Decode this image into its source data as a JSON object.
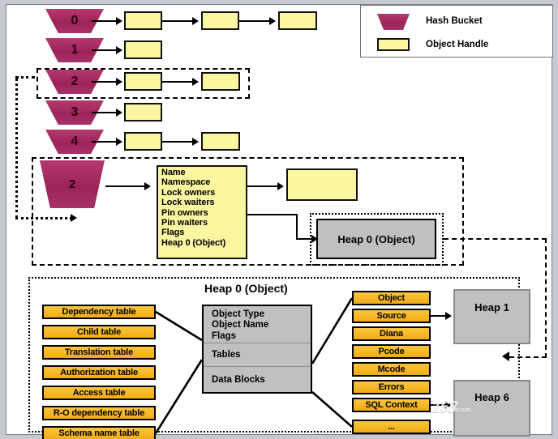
{
  "legend": {
    "items": [
      {
        "label": "Hash Bucket",
        "icon": "trapezoid-icon",
        "color": "#a32a60"
      },
      {
        "label": "Object Handle",
        "icon": "rectangle-icon",
        "color": "#fbf6a0"
      }
    ]
  },
  "hash_table": {
    "buckets": [
      {
        "id": "0",
        "handles": 3
      },
      {
        "id": "1",
        "handles": 1
      },
      {
        "id": "2",
        "handles": 2
      },
      {
        "id": "3",
        "handles": 1
      },
      {
        "id": "4",
        "handles": 2
      }
    ],
    "highlighted_bucket": "2"
  },
  "detail": {
    "bucket_label": "2",
    "handle_fields": [
      "Name",
      "Namespace",
      "Lock owners",
      "Lock waiters",
      "Pin owners",
      "Pin waiters",
      "Flags",
      "Heap 0 (Object)"
    ],
    "next_handle_label": "",
    "heap_box_label": "Heap 0 (Object)"
  },
  "heap_detail": {
    "title": "Heap 0 (Object)",
    "table_sections": [
      {
        "lines": [
          "Object Type",
          "Object Name",
          "Flags"
        ]
      },
      {
        "lines": [
          "Tables"
        ]
      },
      {
        "lines": [
          "Data Blocks"
        ]
      }
    ],
    "tables_list": [
      "Dependency table",
      "Child table",
      "Translation table",
      "Authorization table",
      "Access table",
      "R-O dependency table",
      "Schema name table"
    ],
    "data_blocks_list": [
      "Object",
      "Source",
      "Diana",
      "Pcode",
      "Mcode",
      "Errors",
      "SQL Context",
      "..."
    ],
    "heaps": [
      {
        "label": "Heap 1"
      },
      {
        "label": "Heap 6"
      }
    ]
  },
  "watermark": {
    "text": "168",
    "suffix": "com"
  },
  "colors": {
    "bucket": "#a32a60",
    "handle": "#fbf6a0",
    "orange": "#f5b323",
    "gray": "#c0c0c0",
    "border": "#000000"
  }
}
